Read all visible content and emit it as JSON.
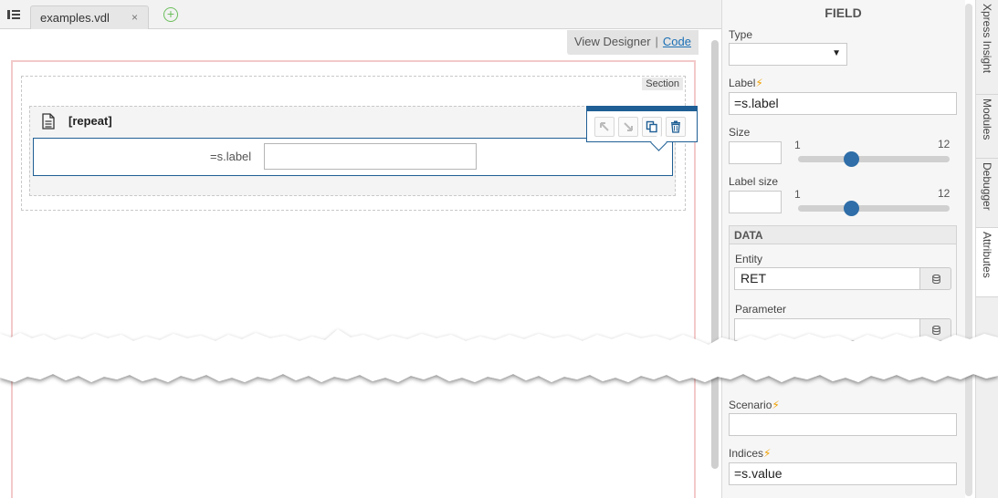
{
  "tabs": {
    "file_name": "examples.vdl",
    "close_glyph": "×",
    "add_glyph": "+"
  },
  "editor": {
    "view_mode": "View Designer",
    "separator": "|",
    "code_link": "Code",
    "section_tag": "Section",
    "repeat_title": "[repeat]",
    "field_label": "=s.label",
    "toolbar_icons": [
      "move-up-icon",
      "move-down-icon",
      "duplicate-icon",
      "delete-icon"
    ]
  },
  "panel": {
    "title": "FIELD",
    "type": {
      "label": "Type",
      "value": ""
    },
    "label": {
      "label": "Label",
      "value": "=s.label"
    },
    "size": {
      "label": "Size",
      "value": "",
      "min": "1",
      "max": "12",
      "level": 0.35
    },
    "label_size": {
      "label": "Label size",
      "value": "",
      "min": "1",
      "max": "12",
      "level": 0.35
    },
    "data": {
      "header": "DATA",
      "entity": {
        "label": "Entity",
        "value": "RET"
      },
      "parameter": {
        "label": "Parameter",
        "value": ""
      }
    },
    "scenario": {
      "label": "Scenario",
      "value": ""
    },
    "indices": {
      "label": "Indices",
      "value": "=s.value"
    },
    "bolt_glyph": "⚡"
  },
  "side_tabs": [
    "Xpress Insight",
    "Modules",
    "Debugger",
    "Attributes"
  ],
  "colors": {
    "accent": "#1f5f95",
    "slider_thumb": "#2f6ea8",
    "link": "#1a6fb5",
    "canvas_border": "#f3c9c9",
    "bolt": "#f0a000",
    "add_icon": "#6bbf5b"
  }
}
